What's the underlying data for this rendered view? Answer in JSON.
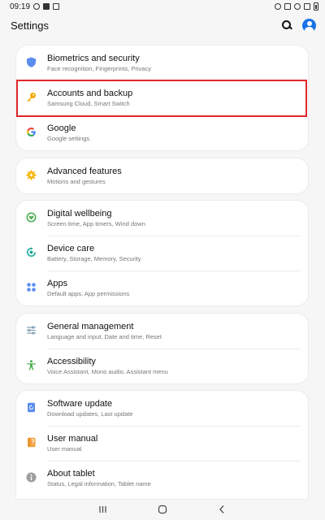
{
  "status_bar": {
    "time": "09:19"
  },
  "header": {
    "title": "Settings"
  },
  "groups": [
    {
      "items": [
        {
          "title": "Biometrics and security",
          "subtitle": "Face recognition, Fingerprints, Privacy",
          "icon": "shield-icon",
          "color": "#5b8def"
        },
        {
          "title": "Accounts and backup",
          "subtitle": "Samsung Cloud, Smart Switch",
          "icon": "key-icon",
          "color": "#f2a900"
        },
        {
          "title": "Google",
          "subtitle": "Google settings",
          "icon": "google-icon",
          "color": "#4285f4"
        }
      ]
    },
    {
      "items": [
        {
          "title": "Advanced features",
          "subtitle": "Motions and gestures",
          "icon": "gear-plus-icon",
          "color": "#f5b400"
        }
      ]
    },
    {
      "items": [
        {
          "title": "Digital wellbeing",
          "subtitle": "Screen time, App timers, Wind down",
          "icon": "heart-circle-icon",
          "color": "#4caf50"
        },
        {
          "title": "Device care",
          "subtitle": "Battery, Storage, Memory, Security",
          "icon": "refresh-circle-icon",
          "color": "#1fa89a"
        },
        {
          "title": "Apps",
          "subtitle": "Default apps, App permissions",
          "icon": "apps-grid-icon",
          "color": "#5b8def"
        }
      ]
    },
    {
      "items": [
        {
          "title": "General management",
          "subtitle": "Language and input, Date and time, Reset",
          "icon": "sliders-icon",
          "color": "#8aa3b5"
        },
        {
          "title": "Accessibility",
          "subtitle": "Voice Assistant, Mono audio, Assistant menu",
          "icon": "accessibility-icon",
          "color": "#4caf50"
        }
      ]
    },
    {
      "items": [
        {
          "title": "Software update",
          "subtitle": "Download updates, Last update",
          "icon": "update-icon",
          "color": "#5b8def"
        },
        {
          "title": "User manual",
          "subtitle": "User manual",
          "icon": "manual-icon",
          "color": "#f2a13b"
        },
        {
          "title": "About tablet",
          "subtitle": "Status, Legal information, Tablet name",
          "icon": "info-icon",
          "color": "#9e9e9e"
        }
      ]
    }
  ]
}
